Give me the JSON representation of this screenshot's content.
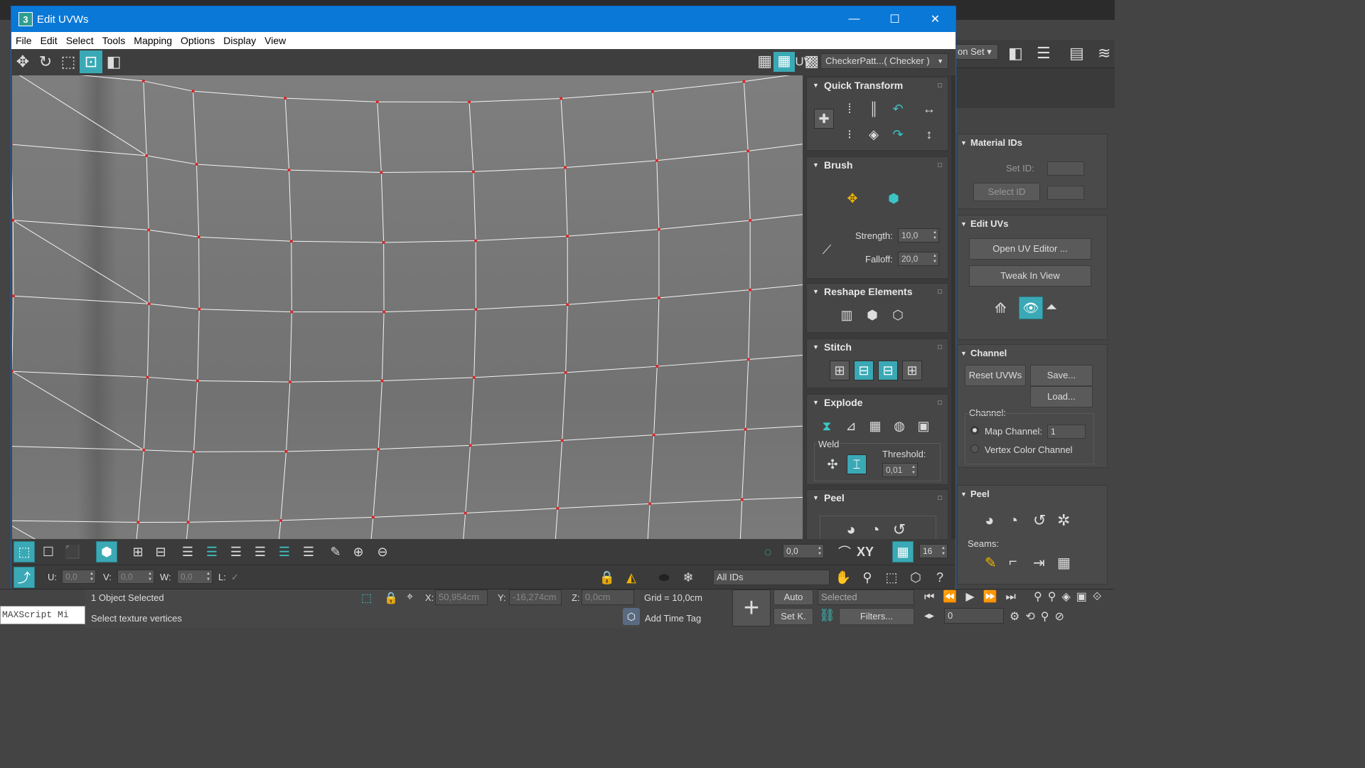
{
  "main_window": {
    "statusbar": {
      "objects_selected": "1 Object Selected",
      "prompt": "Select texture vertices",
      "x_label": "X:",
      "x_value": "50,954cm",
      "y_label": "Y:",
      "y_value": "-16,274cm",
      "z_label": "Z:",
      "z_value": "0,0cm",
      "grid": "Grid = 10,0cm",
      "add_time_tag": "Add Time Tag",
      "auto_label": "Auto",
      "set_key_label": "Set K.",
      "selected_dropdown": "Selected",
      "filters_label": "Filters...",
      "frame_value": "0",
      "maxscript_label": "MAXScript Mi"
    },
    "top_toolbar": {
      "selection_set_partial": "on Set"
    },
    "command_panel": {
      "material_ids": {
        "title": "Material IDs",
        "set_id_label": "Set ID:",
        "select_id_label": "Select ID"
      },
      "edit_uvs": {
        "title": "Edit UVs",
        "open_uv_editor": "Open UV Editor ...",
        "tweak_in_view": "Tweak In View"
      },
      "channel": {
        "title": "Channel",
        "reset_uvws": "Reset UVWs",
        "save": "Save...",
        "load": "Load...",
        "channel_label": "Channel:",
        "map_channel_label": "Map Channel:",
        "map_channel_value": "1",
        "vertex_color_channel": "Vertex Color Channel"
      },
      "peel": {
        "title": "Peel",
        "seams_label": "Seams:"
      }
    }
  },
  "uvw_window": {
    "title": "Edit UVWs",
    "menu": [
      "File",
      "Edit",
      "Select",
      "Tools",
      "Mapping",
      "Options",
      "Display",
      "View"
    ],
    "uv_label": "UV",
    "checker_dropdown": "CheckerPatt...( Checker )",
    "side": {
      "quick_transform": {
        "title": "Quick Transform"
      },
      "brush": {
        "title": "Brush",
        "strength_label": "Strength:",
        "strength_value": "10,0",
        "falloff_label": "Falloff:",
        "falloff_value": "20,0"
      },
      "reshape": {
        "title": "Reshape Elements"
      },
      "stitch": {
        "title": "Stitch"
      },
      "explode": {
        "title": "Explode",
        "weld_label": "Weld",
        "threshold_label": "Threshold:",
        "threshold_value": "0,01"
      },
      "peel": {
        "title": "Peel"
      }
    },
    "bottom": {
      "rotate_value": "0,0",
      "xy_label": "XY",
      "grid_value": "16",
      "u_label": "U:",
      "u_value": "0,0",
      "v_label": "V:",
      "v_value": "0,0",
      "w_label": "W:",
      "w_value": "0,0",
      "l_label": "L:",
      "ids_dropdown": "All IDs"
    }
  }
}
